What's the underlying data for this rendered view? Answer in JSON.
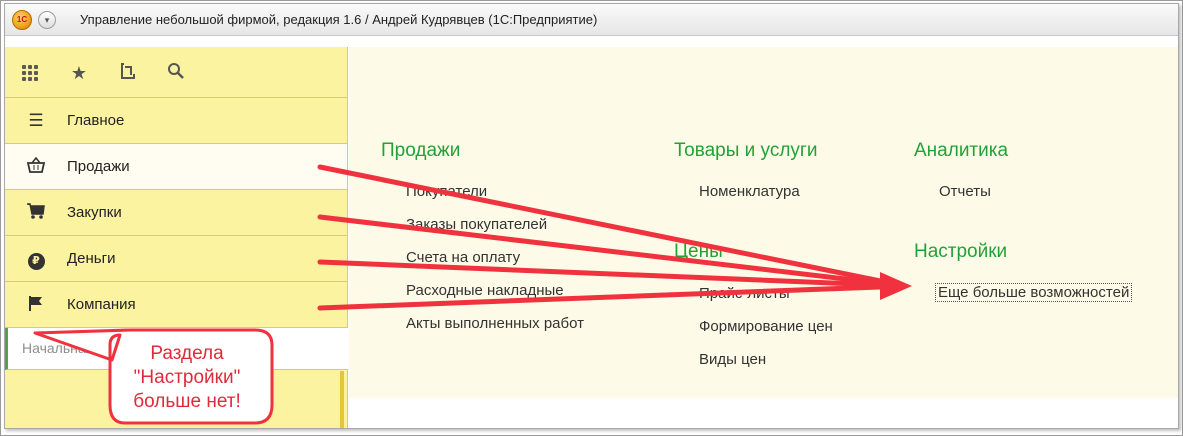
{
  "window": {
    "title": "Управление небольшой фирмой, редакция 1.6 / Андрей Кудрявцев  (1С:Предприятие)",
    "logo_text": "1С"
  },
  "sidebar": {
    "toolbar_icons": [
      "apps-grid-icon",
      "star-icon",
      "history-icon",
      "search-icon"
    ],
    "items": [
      {
        "label": "Главное",
        "icon": "menu-lines-icon"
      },
      {
        "label": "Продажи",
        "icon": "basket-icon"
      },
      {
        "label": "Закупки",
        "icon": "cart-icon"
      },
      {
        "label": "Деньги",
        "icon": "ruble-coin-icon"
      },
      {
        "label": "Компания",
        "icon": "flag-icon"
      }
    ],
    "start_field": "Начальная"
  },
  "content": {
    "sales": {
      "title": "Продажи",
      "links": [
        "Покупатели",
        "Заказы покупателей",
        "Счета на оплату",
        "Расходные накладные",
        "Акты выполненных работ"
      ]
    },
    "goods": {
      "title": "Товары и услуги",
      "links": [
        "Номенклатура"
      ]
    },
    "prices": {
      "title": "Цены",
      "links": [
        "Прайс-листы",
        "Формирование цен",
        "Виды цен"
      ]
    },
    "analytics": {
      "title": "Аналитика",
      "links": [
        "Отчеты"
      ]
    },
    "settings": {
      "title": "Настройки",
      "links": [
        "Еще больше возможностей"
      ]
    }
  },
  "annotation": {
    "callout_text": "Раздела\n\"Настройки\"\nбольше нет!",
    "arrow_color": "#f0323f"
  }
}
